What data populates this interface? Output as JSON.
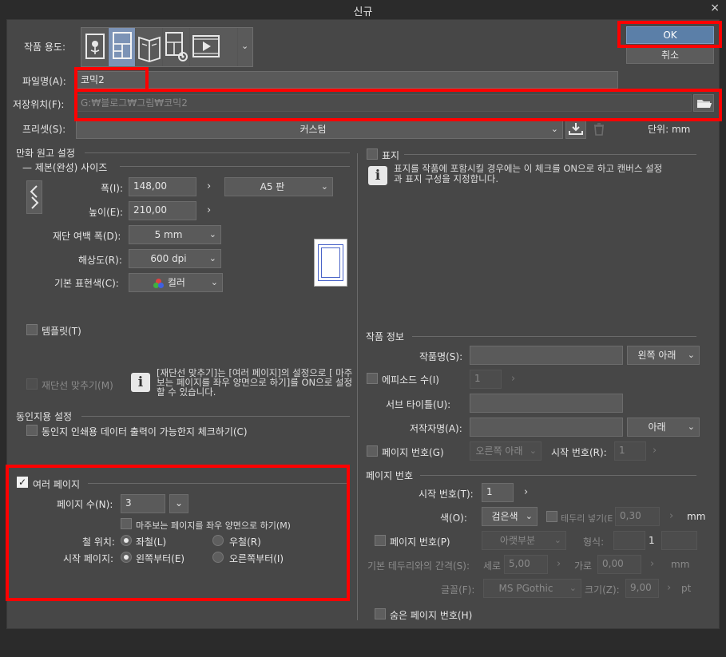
{
  "window": {
    "title": "신규",
    "close": "×"
  },
  "header": {
    "usage_label": "작품 용도:",
    "usage_icons": [
      "illustration-icon",
      "comic-icon",
      "book-icon",
      "comic-settings-icon",
      "animation-icon"
    ],
    "ok_label": "OK",
    "cancel_label": "취소",
    "filename_label": "파일명(A):",
    "filename_value": "코믹2",
    "location_label": "저장위치(F):",
    "location_value": "G:₩블로그₩그림₩코믹2",
    "preset_label": "프리셋(S):",
    "preset_value": "커스텀",
    "unit_label": "단위:",
    "unit_value": "mm"
  },
  "left": {
    "manuscript_title": "만화 원고 설정",
    "size_title": "제본(완성) 사이즈",
    "width_label": "폭(I):",
    "width_value": "148,00",
    "height_label": "높이(E):",
    "height_value": "210,00",
    "paper_value": "A5 판",
    "bleed_label": "재단 여백 폭(D):",
    "bleed_value": "5 mm",
    "resolution_label": "해상도(R):",
    "resolution_value": "600 dpi",
    "color_label": "기본 표현색(C):",
    "color_value": "컬러",
    "template_label": "템플릿(T)",
    "crop_label": "재단선 맞추기(M)",
    "crop_info": "[재단선 맞추기]는 [여러 페이지]의 설정으로 [ 마주보는 페이지를 좌우 양면으로 하기]를 ON으로 설정할 수 있습니다.",
    "doujin_title": "동인지용 설정",
    "doujin_check": "동인지 인쇄용 데이터 출력이 가능한지 체크하기(C)",
    "multi_label": "여러 페이지",
    "pages_label": "페이지 수(N):",
    "pages_value": "3",
    "facing_label": "마주보는 페이지를 좌우 양면으로 하기(M)",
    "binding_label": "철 위치:",
    "binding_left": "좌철(L)",
    "binding_right": "우철(R)",
    "start_label": "시작 페이지:",
    "start_left": "왼쪽부터(E)",
    "start_right": "오른쪽부터(I)"
  },
  "right": {
    "cover_label": "표지",
    "cover_info": "표지를 작품에 포함시킬 경우에는 이 체크를 ON으로 하고 캔버스 설정과 표지 구성을 지정합니다.",
    "work_info_title": "작품 정보",
    "work_name_label": "작품명(S):",
    "work_name_pos": "왼쪽 아래",
    "episode_label": "에피소드 수(I)",
    "episode_value": "1",
    "subtitle_label": "서브 타이틀(U):",
    "author_label": "저작자명(A):",
    "author_pos": "아래",
    "page_num_label": "페이지 번호(G)",
    "page_num_pos": "오른쪽 아래",
    "page_start_label": "시작 번호(R):",
    "page_start_value": "1",
    "numbering_title": "페이지 번호",
    "num_start_label": "시작 번호(T):",
    "num_start_value": "1",
    "num_color_label": "색(O):",
    "num_color_value": "검은색",
    "border_label": "테두리 넣기(E",
    "border_value": "0,30",
    "border_unit": "mm",
    "num_page_label": "페이지 번호(P)",
    "num_page_pos": "아랫부분",
    "format_label": "형식:",
    "format_value": "1",
    "spacing_label": "기본 테두리와의 간격(S):",
    "vertical_label": "세로",
    "vertical_value": "5,00",
    "horizontal_label": "가로",
    "horizontal_value": "0,00",
    "spacing_unit": "mm",
    "font_label": "글꼴(F):",
    "font_value": "MS PGothic",
    "size_label": "크기(Z):",
    "size_value": "9,00",
    "size_unit": "pt",
    "hidden_label": "숨은 페이지 번호(H)"
  }
}
